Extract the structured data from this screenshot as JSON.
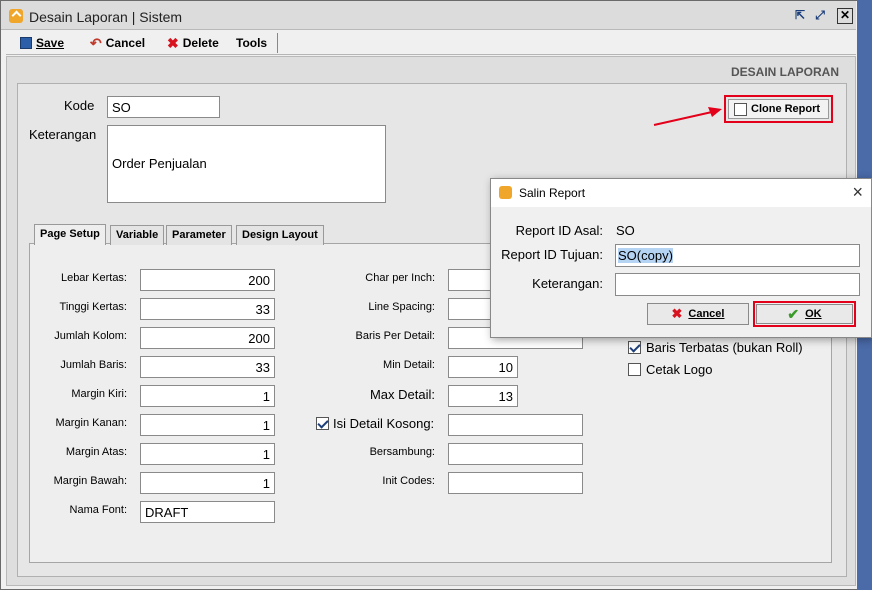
{
  "window": {
    "title": "Desain Laporan | Sistem"
  },
  "toolbar": {
    "save": "Save",
    "cancel": "Cancel",
    "delete": "Delete",
    "tools": "Tools"
  },
  "section_title": "DESAIN LAPORAN",
  "form": {
    "kode_label": "Kode",
    "kode_value": "SO",
    "keterangan_label": "Keterangan",
    "keterangan_value": "Order Penjualan",
    "clone_report": "Clone Report"
  },
  "tabs": [
    "Page Setup",
    "Variable",
    "Parameter",
    "Design Layout"
  ],
  "page_setup": {
    "left": [
      {
        "label": "Lebar Kertas:",
        "value": "200",
        "align": "right"
      },
      {
        "label": "Tinggi Kertas:",
        "value": "33",
        "align": "right"
      },
      {
        "label": "Jumlah Kolom:",
        "value": "200",
        "align": "right"
      },
      {
        "label": "Jumlah Baris:",
        "value": "33",
        "align": "right"
      },
      {
        "label": "Margin Kiri:",
        "value": "1",
        "align": "right"
      },
      {
        "label": "Margin Kanan:",
        "value": "1",
        "align": "right"
      },
      {
        "label": "Margin Atas:",
        "value": "1",
        "align": "right"
      },
      {
        "label": "Margin Bawah:",
        "value": "1",
        "align": "right"
      },
      {
        "label": "Nama Font:",
        "value": "DRAFT",
        "align": "left"
      }
    ],
    "mid": {
      "char_per_inch": "Char per Inch:",
      "line_spacing": "Line Spacing:",
      "baris_per_detail": "Baris Per Detail:",
      "min_detail": "Min Detail:",
      "min_detail_value": "10",
      "max_detail": "Max Detail:",
      "max_detail_value": "13",
      "isi_detail_kosong": "Isi Detail Kosong:",
      "bersambung": "Bersambung:",
      "init_codes": "Init Codes:"
    },
    "right": {
      "baris_terbatas": "Baris Terbatas (bukan Roll)",
      "cetak_logo": "Cetak Logo"
    }
  },
  "dialog": {
    "title": "Salin Report",
    "asal_label": "Report ID Asal:",
    "asal_value": "SO",
    "tujuan_label": "Report ID Tujuan:",
    "tujuan_value": "SO(copy)",
    "keterangan_label": "Keterangan:",
    "cancel": "Cancel",
    "ok": "OK"
  },
  "colors": {
    "highlight": "#e3001a",
    "accent_strip": "#4a6aa8",
    "selection": "#b5d3f3"
  }
}
